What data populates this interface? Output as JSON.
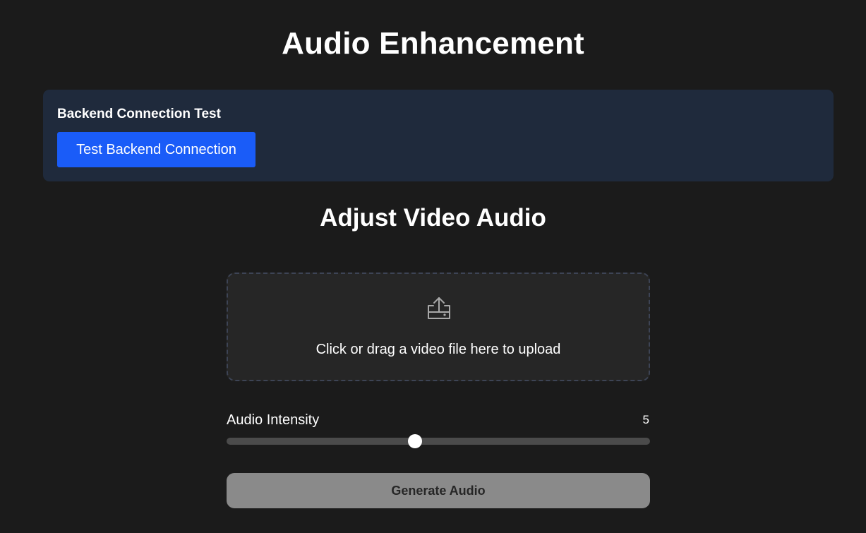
{
  "page": {
    "title": "Audio Enhancement"
  },
  "connection_test": {
    "heading": "Backend Connection Test",
    "button_label": "Test Backend Connection",
    "button_color": "#1a5cf8",
    "card_color": "#1f2a3c"
  },
  "adjust": {
    "title": "Adjust Video Audio",
    "upload": {
      "icon": "upload-icon",
      "text": "Click or drag a video file here to upload"
    },
    "slider": {
      "label": "Audio Intensity",
      "value": "5",
      "fraction": 0.445
    },
    "generate_label": "Generate Audio",
    "generate_enabled": false
  },
  "colors": {
    "background": "#1b1b1b",
    "disabled_button": "#8a8a8a"
  }
}
